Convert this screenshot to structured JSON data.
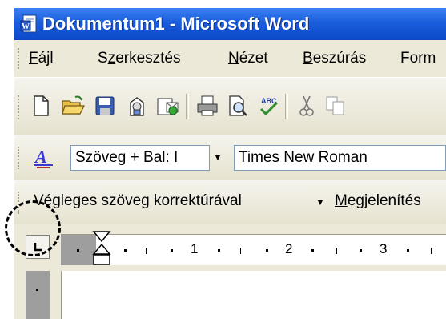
{
  "window": {
    "title": "Dokumentum1 - Microsoft Word"
  },
  "menubar": {
    "items": [
      {
        "label": "Fájl",
        "accel": "F",
        "rest": "ájl"
      },
      {
        "label": "Szerkesztés",
        "pre": "S",
        "accel": "z",
        "rest": "erkesztés"
      },
      {
        "label": "Nézet",
        "accel": "N",
        "rest": "ézet"
      },
      {
        "label": "Beszúrás",
        "accel": "B",
        "rest": "eszúrás"
      },
      {
        "label": "Form",
        "accel": "",
        "rest": "Form"
      }
    ]
  },
  "toolbar_standard": {
    "buttons": [
      "new-document-icon",
      "open-icon",
      "save-icon",
      "permission-icon",
      "email-icon",
      "print-icon",
      "print-preview-icon",
      "spelling-icon",
      "cut-icon",
      "copy-icon"
    ]
  },
  "toolbar_formatting": {
    "style_value": "Szöveg + Bal: I",
    "font_value": "Times New Roman"
  },
  "toolbar_reviewing": {
    "display_value": "Végleges szöveg korrektúrával",
    "show_label": "Megjelenítés",
    "show_accel": "M",
    "show_rest": "egjelenítés"
  },
  "ruler": {
    "numbers": [
      "1",
      "2",
      "3"
    ]
  },
  "colors": {
    "titlebar": "#0b49c9",
    "commandbar": "#ece9d8"
  }
}
